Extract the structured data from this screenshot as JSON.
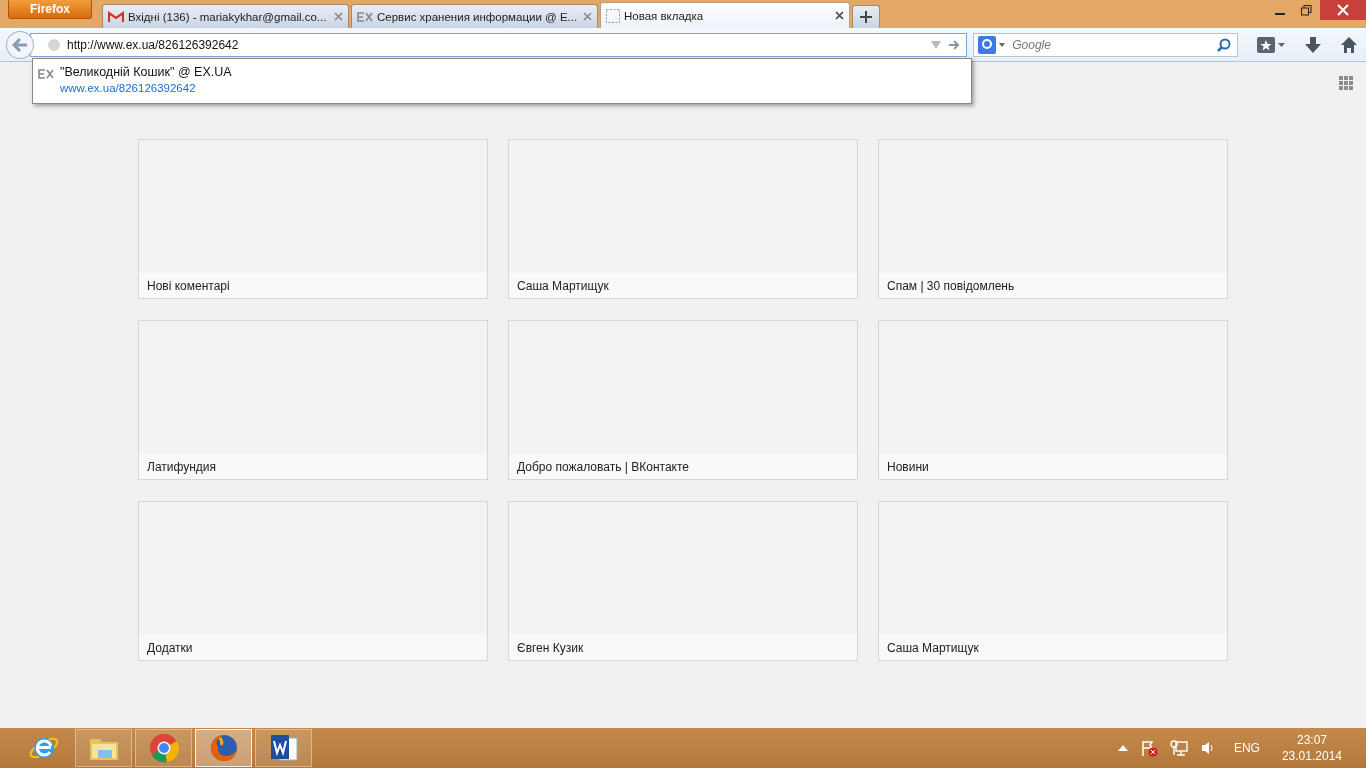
{
  "menu_button": "Firefox",
  "tabs": [
    {
      "kind": "mail",
      "title": "Вхідні (136) - mariakykhar@gmail.co...",
      "selected": false
    },
    {
      "kind": "site",
      "title": "Сервис хранения информации @ E...",
      "selected": false
    },
    {
      "kind": "blank",
      "title": "Новая вкладка",
      "selected": true
    }
  ],
  "address": {
    "value": "http://www.ex.ua/826126392642"
  },
  "search": {
    "placeholder": "Google"
  },
  "suggestion": {
    "title": "\"Великодній Кошик\" @ EX.UA",
    "url": "www.ex.ua/826126392642"
  },
  "tiles": [
    "Нові коментарі",
    "Саша Мартищук",
    "Спам | 30 повідомлень",
    "Латифундия",
    "Добро пожаловать | ВКонтакте",
    "Новини",
    "Додатки",
    "Євген Кузик",
    "Саша Мартищук"
  ],
  "taskbar": {
    "apps": [
      {
        "kind": "ie",
        "running": false,
        "selected": false
      },
      {
        "kind": "folder",
        "running": true,
        "selected": false
      },
      {
        "kind": "chrome",
        "running": true,
        "selected": false
      },
      {
        "kind": "firefox",
        "running": true,
        "selected": true
      },
      {
        "kind": "word",
        "running": true,
        "selected": false
      }
    ],
    "language": "ENG",
    "time": "23:07",
    "date": "23.01.2014"
  }
}
